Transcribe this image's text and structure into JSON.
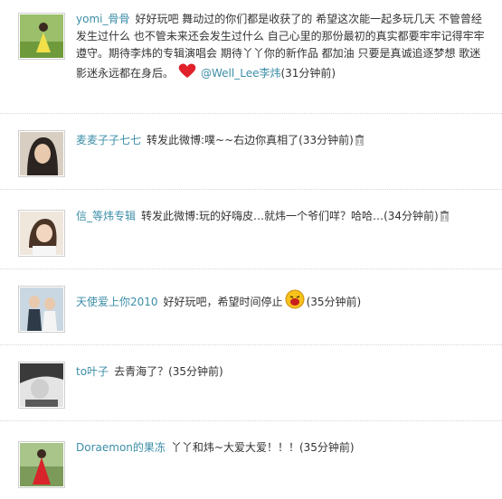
{
  "comments": [
    {
      "user": "yomi_骨骨",
      "text_part1": "好好玩吧  舞动过的你们都是收获了的  希望这次能一起多玩几天  不管曾经发生过什么  也不管未来还会发生过什么  自己心里的那份最初的真实都要牢牢记得牢牢遵守。期待李炜的专辑演唱会  期待丫丫你的新作品  都加油  只要是真诚追逐梦想  歌迷影迷永远都在身后。",
      "mention": "@Well_Lee李炜",
      "time": "(31分钟前)"
    },
    {
      "user": "麦麦子子七七",
      "text": "转发此微博:噗~~右边你真相了",
      "time": "(33分钟前)"
    },
    {
      "user": "信_等炜专辑",
      "text": "转发此微博:玩的好嗨皮…就炜一个爷们咩？哈哈…",
      "time": "(34分钟前)"
    },
    {
      "user": "天使爱上你2010",
      "text": "好好玩吧，希望时间停止",
      "time": "(35分钟前)"
    },
    {
      "user": "to叶子",
      "text": "去青海了？",
      "time": "(35分钟前)"
    },
    {
      "user": "Doraemon的果冻",
      "text": "丫丫和炜~大爱大爱！！！",
      "time": "(35分钟前)"
    }
  ],
  "icons": {
    "heart": "heart-icon",
    "emoji": "laughing-face-icon",
    "delete": "trash-icon"
  },
  "colors": {
    "username": "#3d8ea8",
    "text": "#333333",
    "heart": "#e0202a"
  }
}
